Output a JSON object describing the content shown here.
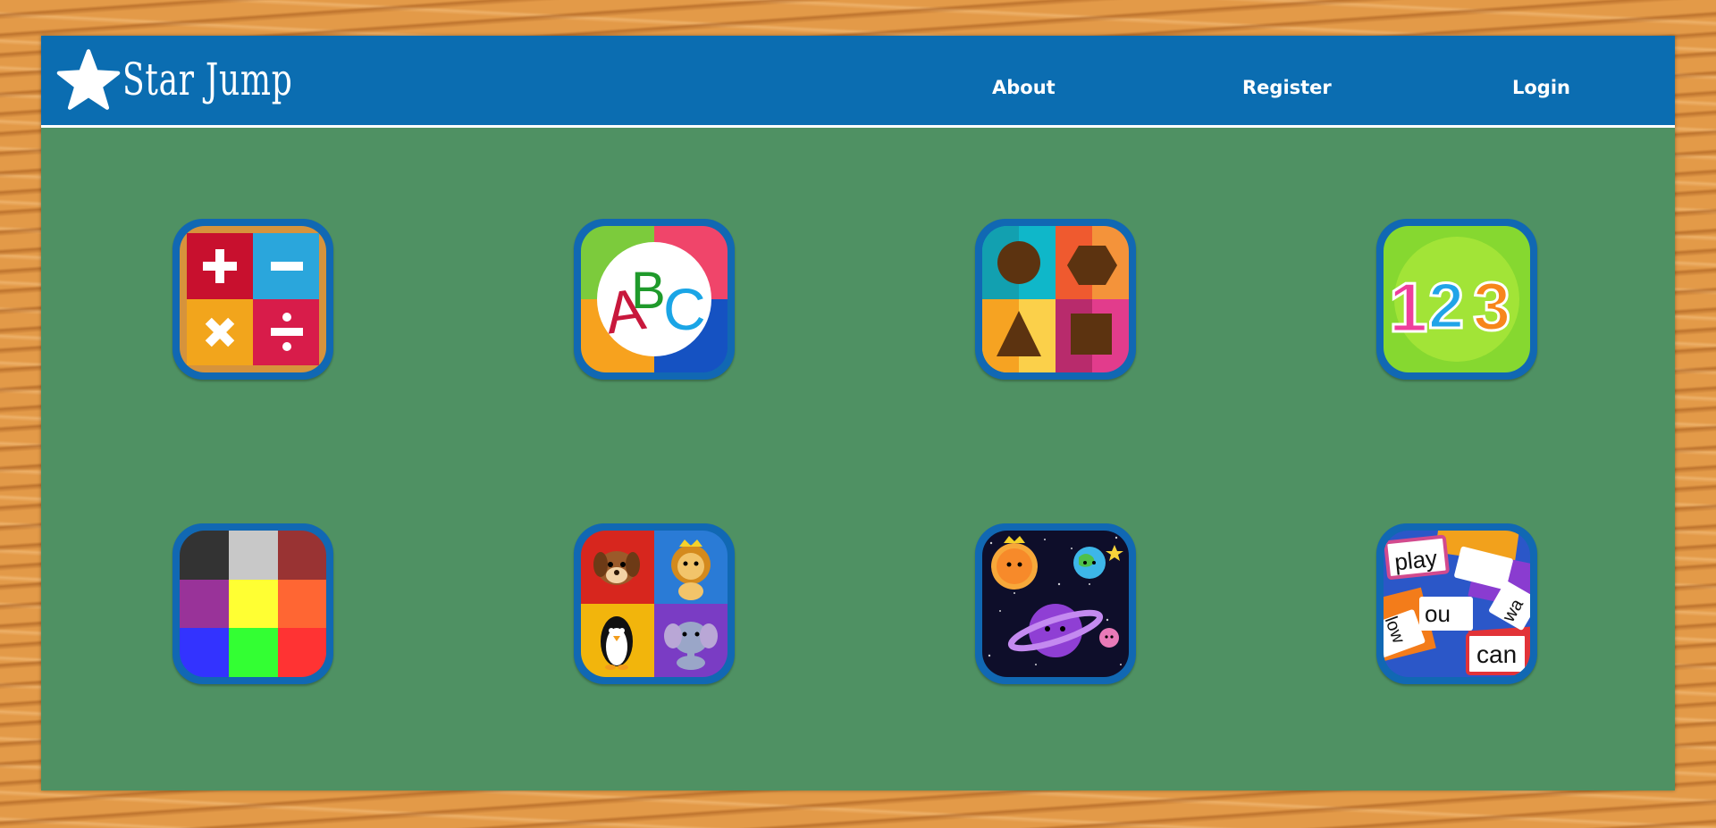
{
  "header": {
    "brand": "Star Jump",
    "nav": {
      "about": "About",
      "register": "Register",
      "login": "Login"
    }
  },
  "games": [
    {
      "icon": "math-operations-icon"
    },
    {
      "icon": "abc-letters-icon"
    },
    {
      "icon": "shapes-icon"
    },
    {
      "icon": "numbers-123-icon"
    },
    {
      "icon": "colors-grid-icon"
    },
    {
      "icon": "animals-icon"
    },
    {
      "icon": "space-planets-icon"
    },
    {
      "icon": "sight-words-icon"
    }
  ],
  "labels_in_icons": {
    "abc": [
      "A",
      "B",
      "C"
    ],
    "numbers": [
      "1",
      "2",
      "3"
    ],
    "words": [
      "play",
      "can",
      "ou",
      "low",
      "wa"
    ]
  },
  "colors": {
    "header": "#0b6db1",
    "board": "#4f9163",
    "frame": "#e39a48",
    "tile_border": "#1168b3"
  }
}
